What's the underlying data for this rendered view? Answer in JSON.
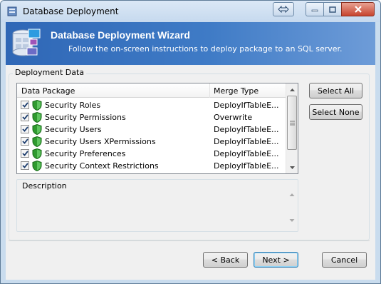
{
  "window": {
    "title": "Database Deployment"
  },
  "header": {
    "title": "Database Deployment Wizard",
    "subtitle": "Follow the on-screen instructions to deploy package to an SQL server."
  },
  "deployment_group": {
    "label": "Deployment Data"
  },
  "list": {
    "columns": [
      "Data Package",
      "Merge Type"
    ],
    "rows": [
      {
        "checked": true,
        "package": "Security Roles",
        "merge": "DeployIfTableE..."
      },
      {
        "checked": true,
        "package": "Security Permissions",
        "merge": "Overwrite"
      },
      {
        "checked": true,
        "package": "Security Users",
        "merge": "DeployIfTableE..."
      },
      {
        "checked": true,
        "package": "Security Users XPermissions",
        "merge": "DeployIfTableE..."
      },
      {
        "checked": true,
        "package": "Security Preferences",
        "merge": "DeployIfTableE..."
      },
      {
        "checked": true,
        "package": "Security Context Restrictions",
        "merge": "DeployIfTableE..."
      }
    ]
  },
  "buttons": {
    "select_all": "Select All",
    "select_none": "Select None",
    "back": "< Back",
    "next": "Next >",
    "cancel": "Cancel"
  },
  "description": {
    "label": "Description",
    "text": ""
  },
  "colors": {
    "header_start": "#2f67b6",
    "header_end": "#6e9cd8",
    "shield": "#2f9a2f",
    "close_button": "#c7442e"
  }
}
